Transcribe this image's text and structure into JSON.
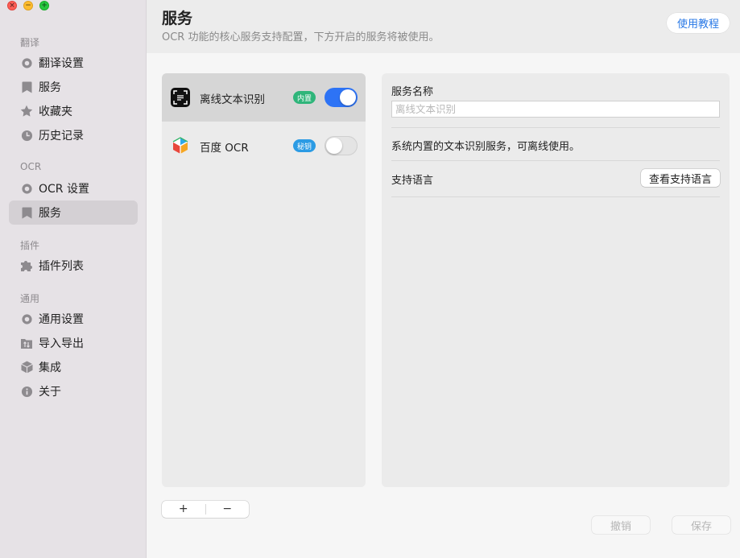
{
  "window": {
    "controls": [
      "close",
      "minimize",
      "maximize"
    ]
  },
  "sidebar": {
    "groups": [
      {
        "label": "翻译",
        "items": [
          {
            "label": "翻译设置",
            "icon": "gear-icon"
          },
          {
            "label": "服务",
            "icon": "bookmark-icon"
          },
          {
            "label": "收藏夹",
            "icon": "star-icon"
          },
          {
            "label": "历史记录",
            "icon": "clock-icon"
          }
        ]
      },
      {
        "label": "OCR",
        "items": [
          {
            "label": "OCR 设置",
            "icon": "gear-icon"
          },
          {
            "label": "服务",
            "icon": "bookmark-icon",
            "active": true
          }
        ]
      },
      {
        "label": "插件",
        "items": [
          {
            "label": "插件列表",
            "icon": "puzzle-icon"
          }
        ]
      },
      {
        "label": "通用",
        "items": [
          {
            "label": "通用设置",
            "icon": "gear-icon"
          },
          {
            "label": "导入导出",
            "icon": "folder-transfer-icon"
          },
          {
            "label": "集成",
            "icon": "cube-icon"
          },
          {
            "label": "关于",
            "icon": "info-icon"
          }
        ]
      }
    ]
  },
  "header": {
    "title": "服务",
    "subtitle": "OCR 功能的核心服务支持配置，下方开启的服务将被使用。",
    "help_button": "使用教程"
  },
  "services": [
    {
      "name": "离线文本识别",
      "badge": "内置",
      "enabled": true,
      "selected": true,
      "icon": "scan-text-icon"
    },
    {
      "name": "百度 OCR",
      "badge": "秘钥",
      "enabled": false,
      "selected": false,
      "icon": "baidu-ocr-icon"
    }
  ],
  "list_actions": {
    "add": "+",
    "remove": "−"
  },
  "detail": {
    "name_label": "服务名称",
    "name_placeholder": "离线文本识别",
    "name_value": "",
    "description": "系统内置的文本识别服务，可离线使用。",
    "languages_label": "支持语言",
    "languages_button": "查看支持语言"
  },
  "footer": {
    "undo": "撤销",
    "save": "保存"
  },
  "colors": {
    "accent": "#2d73f5",
    "builtin_badge": "#2fb57a",
    "key_badge": "#2b9be4",
    "help_link": "#2878e6"
  }
}
